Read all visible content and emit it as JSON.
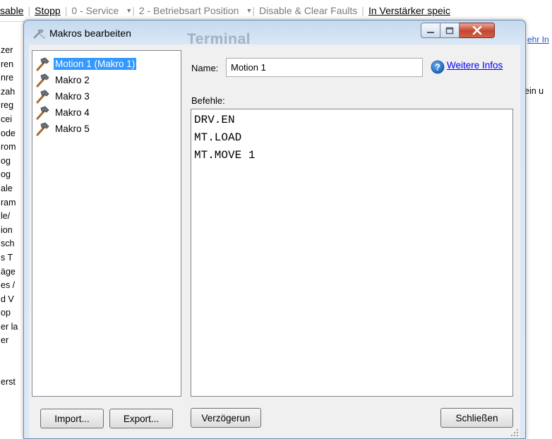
{
  "background": {
    "toolbar": [
      {
        "label": "sable",
        "dark": true
      },
      {
        "label": "Stopp",
        "dark": true
      },
      {
        "label": "0 - Service",
        "dark": false,
        "dropdown": true
      },
      {
        "label": "2 - Betriebsart Position",
        "dark": false,
        "dropdown": true
      },
      {
        "label": "Disable & Clear Faults",
        "dark": false
      },
      {
        "label": "In Verstärker speic",
        "dark": true
      }
    ],
    "left_fragments": [
      "zer",
      "ren",
      "nre",
      "zah",
      "reg",
      "cei",
      "ode",
      "rom",
      "og",
      "og",
      "ale",
      "ram",
      "le/",
      "ion",
      "sch",
      "s T",
      "äge",
      "es /",
      "d V",
      "op",
      "er la",
      "er",
      "",
      "",
      "erst"
    ],
    "right_link": "ehr In",
    "right_text": "ein u",
    "ghost_title": "Terminal"
  },
  "dialog": {
    "title": "Makros bearbeiten",
    "macros": [
      {
        "label": "Motion 1 (Makro 1)",
        "selected": true
      },
      {
        "label": "Makro 2",
        "selected": false
      },
      {
        "label": "Makro 3",
        "selected": false
      },
      {
        "label": "Makro 4",
        "selected": false
      },
      {
        "label": "Makro 5",
        "selected": false
      }
    ],
    "name_label": "Name:",
    "name_value": "Motion 1",
    "help_link": "Weitere Infos",
    "commands_label": "Befehle:",
    "commands": "DRV.EN\nMT.LOAD\nMT.MOVE 1",
    "buttons": {
      "import": "Import...",
      "export": "Export...",
      "delay": "Verzögerun",
      "close": "Schließen"
    }
  },
  "colors": {
    "selection": "#3399ff",
    "link": "#0000ff",
    "close_button": "#c4452e"
  }
}
